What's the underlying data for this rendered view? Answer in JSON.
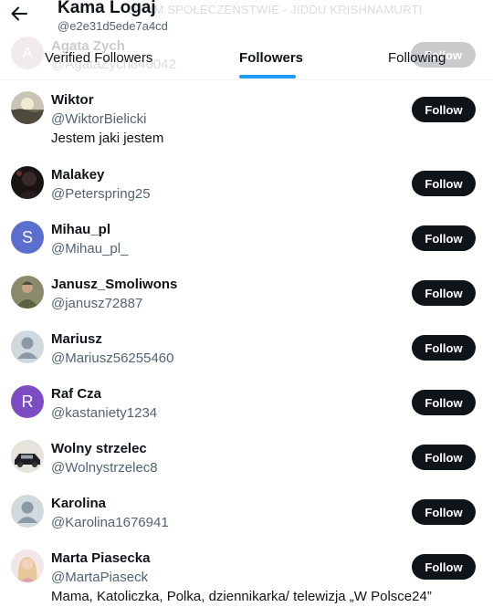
{
  "header": {
    "name": "Kama Logaj",
    "handle": "@e2e31d5ede7a4cd"
  },
  "ghost": {
    "banner": "ORYM SPOŁECZEŃSTWIE - JIDDU KRISHNAMURTI",
    "avatar_letter": "A",
    "name": "Agata Zych",
    "handle": "@AgataZych840042",
    "button": "Follow"
  },
  "tabs": [
    {
      "label": "Verified Followers"
    },
    {
      "label": "Followers"
    },
    {
      "label": "Following"
    }
  ],
  "active_tab": "Followers",
  "colors": {
    "accent": "#1d9bf0",
    "follow_button": "#0f1419",
    "handle_text": "#536471",
    "avatar_blue": "#5b6fcf",
    "avatar_purple": "#7b4cc4"
  },
  "followers": [
    {
      "name": "Wiktor",
      "handle": "@WiktorBielicki",
      "bio": "Jestem jaki jestem",
      "button": "Follow",
      "avatar": "photo-landscape"
    },
    {
      "name": "Malakey",
      "handle": "@Peterspring25",
      "bio": "",
      "button": "Follow",
      "avatar": "photo-dark-portrait"
    },
    {
      "name": "Mihau_pl",
      "handle": "@Mihau_pl_",
      "bio": "",
      "button": "Follow",
      "avatar": "letter",
      "letter": "S"
    },
    {
      "name": "Janusz_Smoliwons",
      "handle": "@janusz72887",
      "bio": "",
      "button": "Follow",
      "avatar": "photo-soldier"
    },
    {
      "name": "Mariusz",
      "handle": "@Mariusz56255460",
      "bio": "",
      "button": "Follow",
      "avatar": "default-person"
    },
    {
      "name": "Raf Cza",
      "handle": "@kastaniety1234",
      "bio": "",
      "button": "Follow",
      "avatar": "letter",
      "letter": "R"
    },
    {
      "name": "Wolny strzelec",
      "handle": "@Wolnystrzelec8",
      "bio": "",
      "button": "Follow",
      "avatar": "photo-car"
    },
    {
      "name": "Karolina",
      "handle": "@Karolina1676941",
      "bio": "",
      "button": "Follow",
      "avatar": "default-person"
    },
    {
      "name": "Marta Piasecka",
      "handle": "@MartaPiaseck",
      "bio": "Mama, Katoliczka, Polka, dziennikarka/ telewizja „W Polsce24”",
      "button": "Follow",
      "avatar": "photo-woman"
    }
  ]
}
